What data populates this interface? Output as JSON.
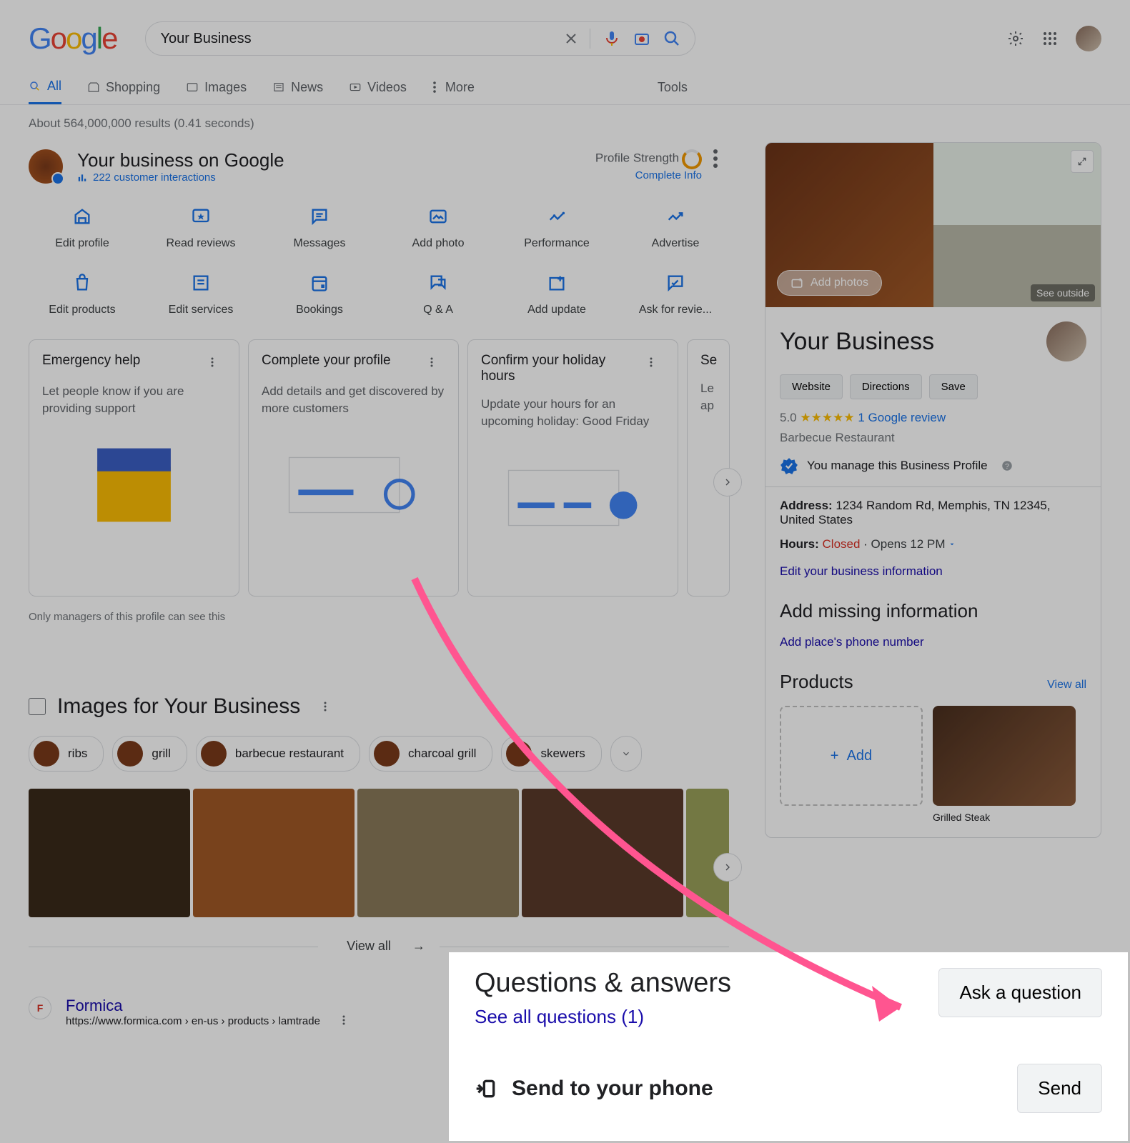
{
  "search": {
    "query": "Your Business"
  },
  "tabs": {
    "all": "All",
    "shopping": "Shopping",
    "images": "Images",
    "news": "News",
    "videos": "Videos",
    "more": "More",
    "tools": "Tools"
  },
  "resultstats": "About 564,000,000 results (0.41 seconds)",
  "bizpanel": {
    "title": "Your business on Google",
    "interactions": "222 customer interactions",
    "profile_strength": {
      "label": "Profile Strength",
      "action": "Complete Info"
    },
    "actions": [
      {
        "label": "Edit profile"
      },
      {
        "label": "Read reviews"
      },
      {
        "label": "Messages"
      },
      {
        "label": "Add photo"
      },
      {
        "label": "Performance"
      },
      {
        "label": "Advertise"
      },
      {
        "label": "Edit products"
      },
      {
        "label": "Edit services"
      },
      {
        "label": "Bookings"
      },
      {
        "label": "Q & A"
      },
      {
        "label": "Add update"
      },
      {
        "label": "Ask for revie..."
      }
    ],
    "cards": [
      {
        "title": "Emergency help",
        "desc": "Let people know if you are providing support"
      },
      {
        "title": "Complete your profile",
        "desc": "Add details and get discovered by more customers"
      },
      {
        "title": "Confirm your holiday hours",
        "desc": "Update your hours for an upcoming holiday: Good Friday"
      },
      {
        "title": "Se",
        "desc": "Le\nap"
      }
    ],
    "manager_note": "Only managers of this profile can see this"
  },
  "images_section": {
    "title": "Images for Your Business",
    "chips": [
      "ribs",
      "grill",
      "barbecue restaurant",
      "charcoal grill",
      "skewers"
    ],
    "view_all": "View all"
  },
  "result": {
    "title": "Formica",
    "url": "https://www.formica.com › en-us › products › lamtrade"
  },
  "kp": {
    "add_photos": "Add photos",
    "see_outside": "See outside",
    "name": "Your Business",
    "buttons": {
      "website": "Website",
      "directions": "Directions",
      "save": "Save"
    },
    "rating": {
      "score": "5.0",
      "stars": "★★★★★",
      "reviews": "1 Google review"
    },
    "category": "Barbecue Restaurant",
    "manage": "You manage this Business Profile",
    "address_label": "Address:",
    "address": "1234 Random Rd, Memphis, TN 12345, United States",
    "hours_label": "Hours:",
    "hours_status": "Closed",
    "hours_opens": "Opens 12 PM",
    "edit_link": "Edit your business information",
    "missing_hdr": "Add missing information",
    "phone_link": "Add place's phone number",
    "products_hdr": "Products",
    "view_all": "View all",
    "add_btn": "Add",
    "product_name": "Grilled Steak"
  },
  "popup": {
    "qa_title": "Questions & answers",
    "qa_link": "See all questions (1)",
    "ask_btn": "Ask a question",
    "send_label": "Send to your phone",
    "send_btn": "Send"
  }
}
